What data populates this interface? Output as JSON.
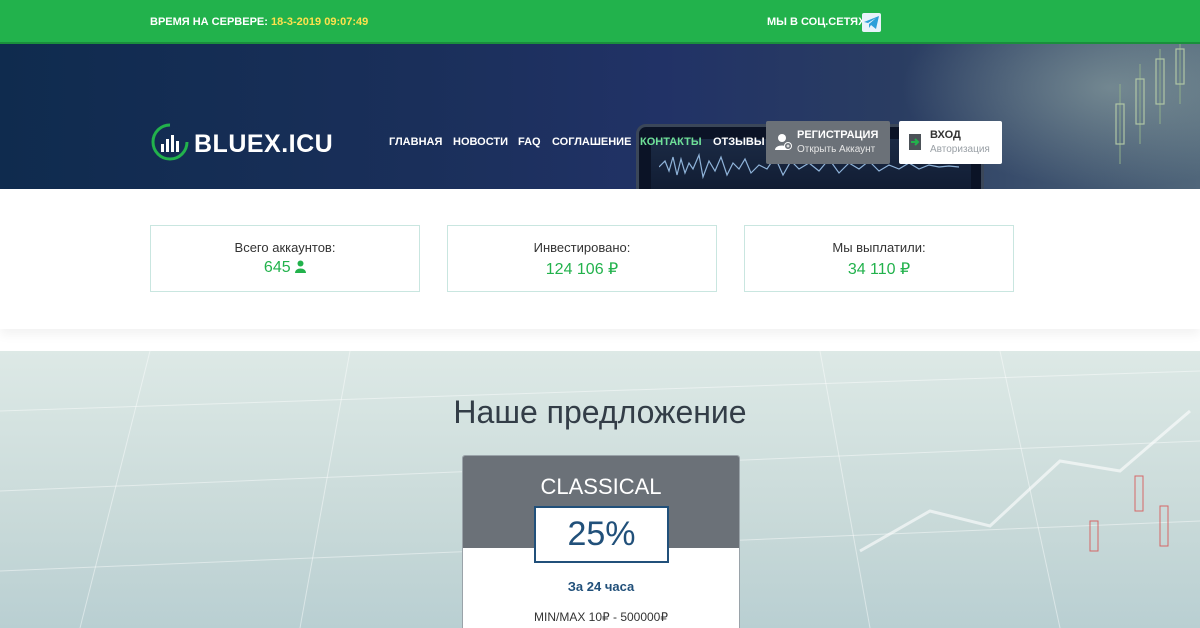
{
  "topbar": {
    "server_label": "ВРЕМЯ НА СЕРВЕРЕ:",
    "server_time": "18-3-2019 09:07:49",
    "social_label": "МЫ В СОЦ.СЕТЯХ:",
    "social_icon": "telegram-icon",
    "bg_color": "#22b24c"
  },
  "header": {
    "logo_text": "BLUEX.ICU",
    "nav": [
      {
        "label": "ГЛАВНАЯ",
        "active": false
      },
      {
        "label": "НОВОСТИ",
        "active": false
      },
      {
        "label": "FAQ",
        "active": false
      },
      {
        "label": "СОГЛАШЕНИЕ",
        "active": false
      },
      {
        "label": "КОНТАКТЫ",
        "active": true
      },
      {
        "label": "ОТЗЫВЫ",
        "active": false
      }
    ],
    "register": {
      "title": "РЕГИСТРАЦИЯ",
      "subtitle": "Открыть Аккаунт",
      "icon": "user-add-icon"
    },
    "login": {
      "title": "ВХОД",
      "subtitle": "Авторизация",
      "icon": "login-icon"
    }
  },
  "stats": [
    {
      "label": "Всего аккаунтов:",
      "value": "645",
      "icon": "user-icon"
    },
    {
      "label": "Инвестировано:",
      "value": "124 106 ₽"
    },
    {
      "label": "Мы выплатили:",
      "value": "34 110 ₽"
    }
  ],
  "offer": {
    "title": "Наше предложение",
    "plan": {
      "name": "CLASSICAL",
      "percent": "25%",
      "period": "За 24 часа",
      "minmax": "MIN/MAX 10₽ - 500000₽"
    }
  },
  "colors": {
    "accent_green": "#22b24c",
    "active_nav": "#6fe098",
    "plan_blue": "#21507a",
    "button_gray": "#6b7178"
  }
}
